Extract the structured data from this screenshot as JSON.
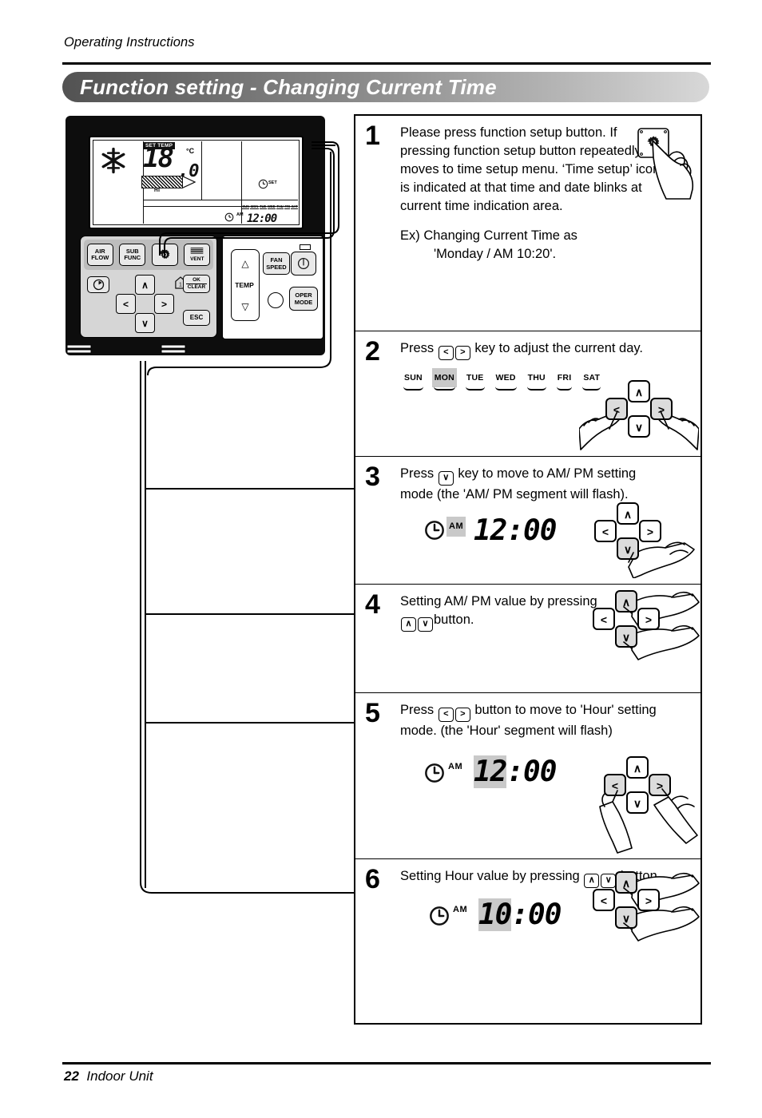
{
  "header": {
    "running_head": "Operating Instructions",
    "title": "Function  setting - Changing Current Time"
  },
  "footer": {
    "page_number": "22",
    "section": "Indoor Unit"
  },
  "remote": {
    "lcd": {
      "set_temp_label": "SET TEMP",
      "temperature": "18",
      "temperature_decimal": ".0",
      "unit": "°C",
      "fan_speed_label": "HI",
      "timer_label": "SET",
      "days": [
        "SUN",
        "MON",
        "TUE",
        "WED",
        "THU",
        "FRI",
        "SAT"
      ],
      "am_pm": "AM",
      "time": "12:00"
    },
    "buttons": {
      "air_flow": "AIR\nFLOW",
      "air_flow_line1": "AIR",
      "air_flow_line2": "FLOW",
      "sub_func_line1": "SUB",
      "sub_func_line2": "FUNC",
      "function_setup_icon": "gear-icon",
      "vent_label": "VENT",
      "timer_icon": "clock-icon",
      "ok_line1": "OK",
      "ok_line2": "CLEAR",
      "esc": "ESC",
      "up": "∧",
      "down": "∨",
      "left": "<",
      "right": ">",
      "temp_label": "TEMP",
      "temp_up": "△",
      "temp_down": "▽",
      "fan_speed_line1": "FAN",
      "fan_speed_line2": "SPEED",
      "oper_mode_line1": "OPER",
      "oper_mode_line2": "MODE"
    }
  },
  "steps": [
    {
      "number": "1",
      "text": "Please press function setup button. If pressing function setup button repeatedly, it moves to time setup menu. ‘Time setup’ icon is indicated at that time and date blinks at current time indication area.",
      "example_lead": "Ex) Changing Current Time as",
      "example_value": "'Monday / AM 10:20'."
    },
    {
      "number": "2",
      "text_before": "Press",
      "key_left": "<",
      "key_right": ">",
      "text_after": "key to adjust the current day.",
      "days": [
        "SUN",
        "MON",
        "TUE",
        "WED",
        "THU",
        "FRI",
        "SAT"
      ],
      "selected_day": "MON"
    },
    {
      "number": "3",
      "text_before": "Press",
      "key": "∨",
      "text_after": "key to move to AM/ PM setting mode (the 'AM/ PM segment will flash).",
      "display_ampm": "AM",
      "display_time": "12:00"
    },
    {
      "number": "4",
      "text_before": "Setting AM/ PM value by pressing",
      "key_up": "∧",
      "key_down": "∨",
      "text_after": "button."
    },
    {
      "number": "5",
      "text_before": "Press",
      "key_left": "<",
      "key_right": ">",
      "text_after": "button to move to 'Hour' setting mode. (the 'Hour' segment will flash)",
      "display_ampm": "AM",
      "display_hour": "12",
      "display_minute": ":00"
    },
    {
      "number": "6",
      "text_before": "Setting Hour value by pressing",
      "key_up": "∧",
      "key_down": "∨",
      "text_after": "button.",
      "display_ampm": "AM",
      "display_hour": "10",
      "display_minute": ":00"
    }
  ],
  "colors": {
    "highlight": "#c9c9c9",
    "title_dark": "#525252",
    "title_light": "#d8d8d8"
  }
}
